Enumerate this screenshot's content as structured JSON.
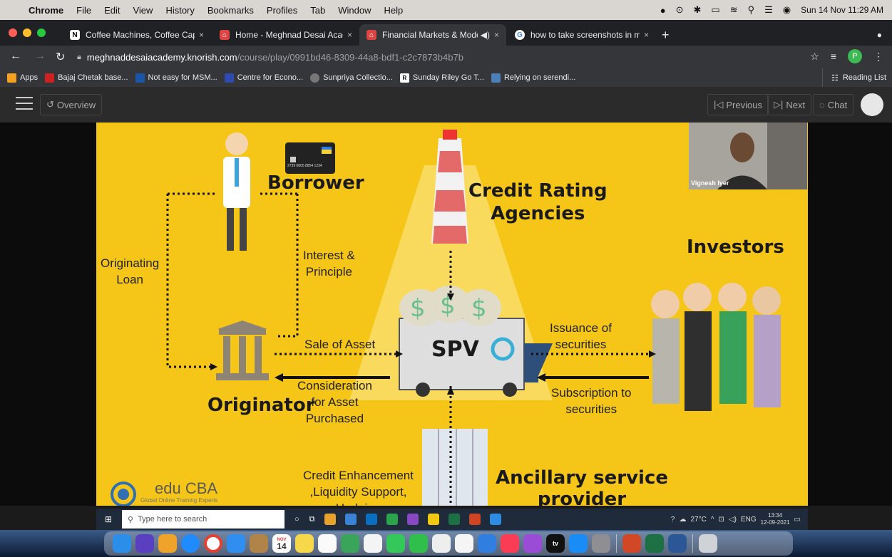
{
  "menubar": {
    "items": [
      "Chrome",
      "File",
      "Edit",
      "View",
      "History",
      "Bookmarks",
      "Profiles",
      "Tab",
      "Window",
      "Help"
    ],
    "datetime": "Sun 14 Nov  11:29 AM"
  },
  "tabs": [
    {
      "title": "Coffee Machines, Coffee Caps",
      "close": "×"
    },
    {
      "title": "Home - Meghnad Desai Acade",
      "close": "×"
    },
    {
      "title": "Financial Markets & Modelli",
      "close": "×"
    },
    {
      "title": "how to take screenshots in ma",
      "close": "×"
    }
  ],
  "newtab": "+",
  "address": {
    "host": "meghnaddesaiacademy.knorish.com",
    "path": "/course/play/0991bd46-8309-44a8-bdf1-c2c7873b4b7b"
  },
  "profile_initial": "P",
  "bookmarks": {
    "items": [
      "Apps",
      "Bajaj Chetak base...",
      "Not easy for MSM...",
      "Centre for Econo...",
      "Sunpriya Collectio...",
      "Sunday Riley Go T...",
      "Relying on serendi..."
    ],
    "reading_list": "Reading List"
  },
  "course_header": {
    "overview": "Overview",
    "previous": "Previous",
    "next": "Next",
    "chat": "Chat"
  },
  "slide": {
    "borrower": "Borrower",
    "cra": "Credit Rating\nAgencies",
    "investors": "Investors",
    "originating_loan": "Originating\nLoan",
    "interest_principle": "Interest &\nPrinciple",
    "sale_of_asset": "Sale of Asset",
    "issuance": "Issuance of\nsecurities",
    "consideration": "Consideration\nfor Asset\nPurchased",
    "subscription": "Subscription to\nsecurities",
    "originator": "Originator",
    "spv": "SPV",
    "credit_enh": "Credit Enhancement\n,Liquidity Support,\nHedging",
    "ancillary": "Ancillary service\nprovider",
    "card_number": "2739 6805 8854 1234",
    "educba": "edu CBA",
    "educba_sub": "Global Online Training Experts"
  },
  "webcam_name": "Vignesh Iyer",
  "taskbar": {
    "search": "Type here to search",
    "weather": "27°C",
    "lang": "ENG",
    "time": "13:34",
    "date": "12-09-2021"
  },
  "dock_calendar": {
    "month": "NOV",
    "day": "14"
  }
}
